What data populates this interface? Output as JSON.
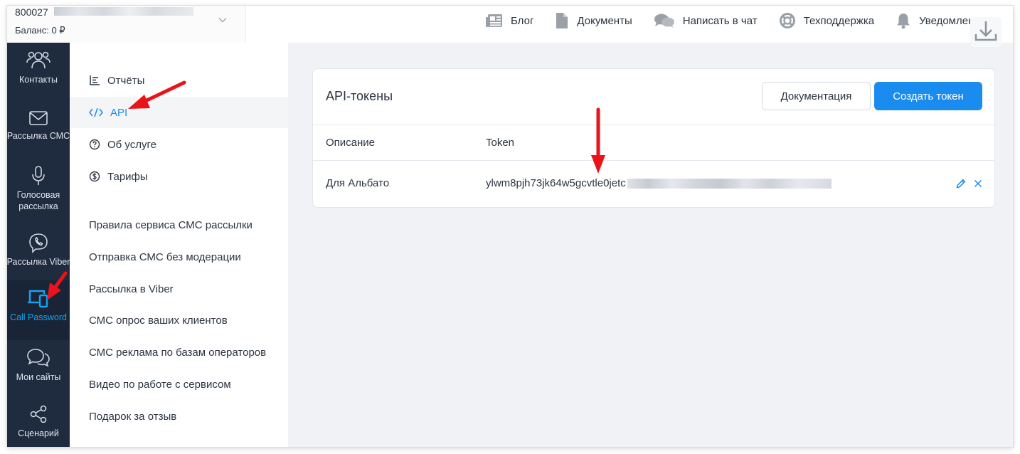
{
  "account": {
    "number": "800027",
    "balance": "Баланс: 0 ₽"
  },
  "top_nav": [
    {
      "label": "Блог",
      "icon": "newspaper-icon"
    },
    {
      "label": "Документы",
      "icon": "document-icon"
    },
    {
      "label": "Написать в чат",
      "icon": "chat-icon"
    },
    {
      "label": "Техподдержка",
      "icon": "lifebuoy-icon"
    },
    {
      "label": "Уведомления",
      "icon": "bell-icon"
    }
  ],
  "sidebar": {
    "items": [
      {
        "label": "Контакты",
        "icon": "contacts-icon"
      },
      {
        "label": "Рассылка СМС",
        "icon": "envelope-icon"
      },
      {
        "label": "Голосовая рассылка",
        "icon": "microphone-icon"
      },
      {
        "label": "Рассылка Viber",
        "icon": "viber-icon"
      },
      {
        "label": "Call Password",
        "icon": "devices-icon"
      },
      {
        "label": "Мои сайты",
        "icon": "sites-chat-icon"
      },
      {
        "label": "Сценарий",
        "icon": "share-icon"
      }
    ]
  },
  "submenu": {
    "items": [
      {
        "label": "Отчёты",
        "icon": "chart-icon"
      },
      {
        "label": "API",
        "icon": "code-icon"
      },
      {
        "label": "Об услуге",
        "icon": "question-icon"
      },
      {
        "label": "Тарифы",
        "icon": "coin-icon"
      }
    ],
    "links": [
      "Правила сервиса СМС рассылки",
      "Отправка СМС без модерации",
      "Рассылка в Viber",
      "СМС опрос ваших клиентов",
      "СМС реклама по базам операторов",
      "Видео по работе с сервисом",
      "Подарок за отзыв"
    ]
  },
  "card": {
    "title": "API-токены",
    "doc_button": "Документация",
    "create_button": "Создать токен",
    "columns": {
      "description": "Описание",
      "token": "Token"
    },
    "rows": [
      {
        "description": "Для Альбато",
        "token": "ylwm8pjh73jk64w5gcvtle0jetc"
      }
    ]
  },
  "colors": {
    "accent": "#1a8cf0",
    "sidebar_bg": "#1f2b3e",
    "active_icon": "#16a4f2",
    "annotation": "#e8131b"
  }
}
